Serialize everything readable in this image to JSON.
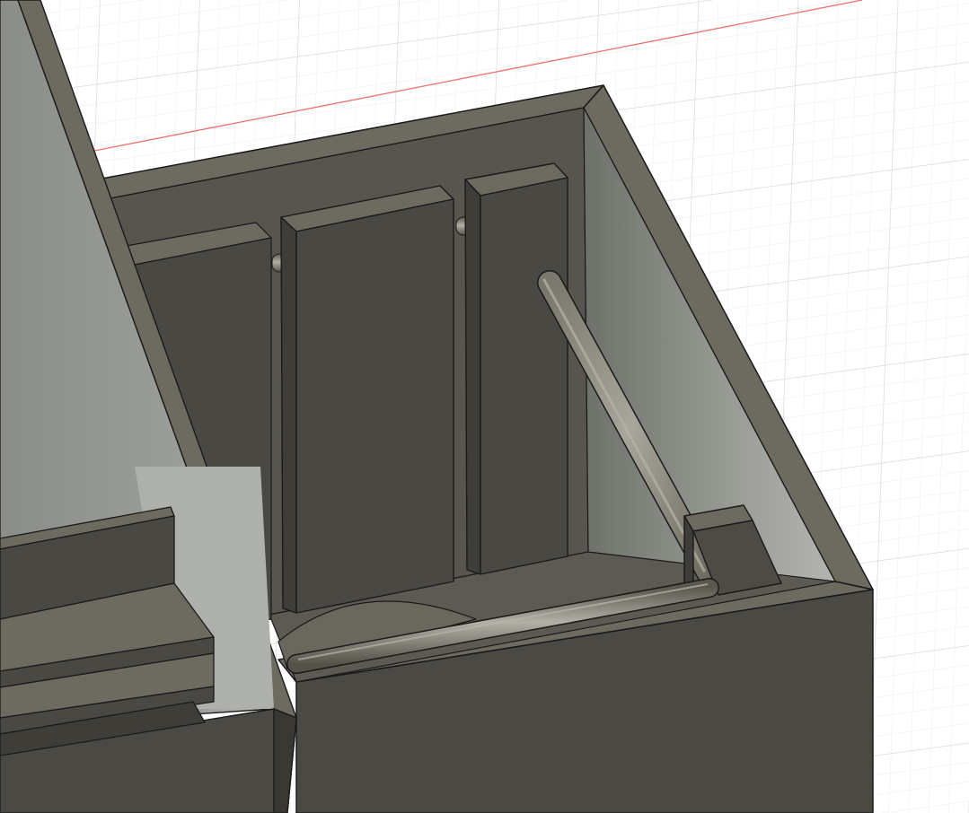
{
  "viewport": {
    "description_visible_text": [],
    "colors": {
      "background": "#ffffff",
      "grid_minor": "#ebebeb",
      "grid_major": "#d7d7d7",
      "axis_red": "#f06a6a",
      "model_dark": "#4a4842",
      "model_mid": "#5a5850",
      "model_top": "#6c695f",
      "model_light_wall": "#8a8c86",
      "edge": "#1a1a1a"
    }
  }
}
